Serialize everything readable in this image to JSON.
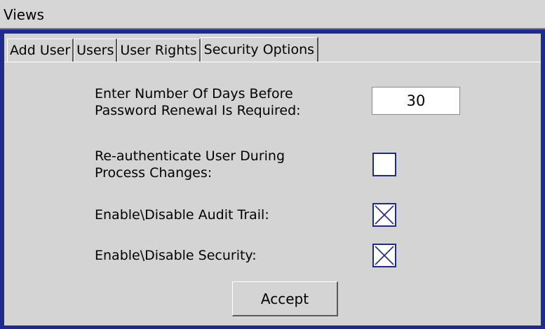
{
  "window": {
    "title": "Views"
  },
  "tabs": [
    {
      "label": "Add User",
      "active": false
    },
    {
      "label": "Users",
      "active": false
    },
    {
      "label": "User Rights",
      "active": false
    },
    {
      "label": "Security Options",
      "active": true
    }
  ],
  "security_options": {
    "days_label_line1": "Enter Number Of Days Before",
    "days_label_line2": "Password Renewal Is Required:",
    "days_value": "30",
    "reauth_label_line1": "Re-authenticate User During",
    "reauth_label_line2": "Process Changes:",
    "reauth_checked": false,
    "audit_label": "Enable\\Disable Audit Trail:",
    "audit_checked": true,
    "security_label": "Enable\\Disable Security:",
    "security_checked": true,
    "accept_label": "Accept"
  },
  "colors": {
    "frame": "#1e2a8c",
    "panel": "#d4d4d4",
    "checkbox_border": "#1e2a8c"
  }
}
